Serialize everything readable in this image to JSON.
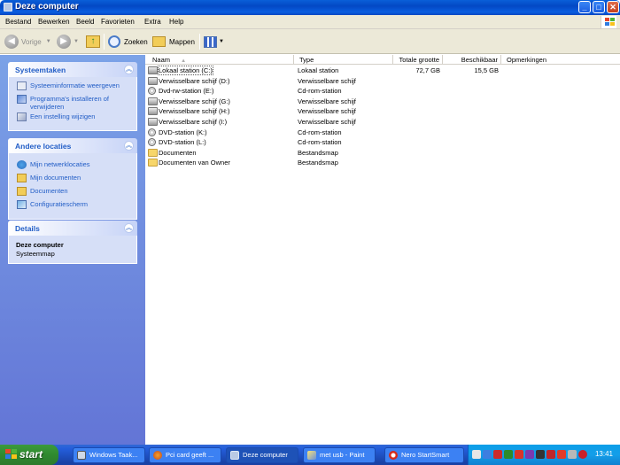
{
  "window": {
    "title": "Deze computer"
  },
  "menu": [
    "Bestand",
    "Bewerken",
    "Beeld",
    "Favorieten",
    "Extra",
    "Help"
  ],
  "toolbar": {
    "back": "Vorige",
    "search": "Zoeken",
    "folders": "Mappen"
  },
  "tasks_system": {
    "title": "Systeemtaken",
    "items": [
      "Systeeminformatie weergeven",
      "Programma's installeren of verwijderen",
      "Een instelling wijzigen"
    ]
  },
  "tasks_other": {
    "title": "Andere locaties",
    "items": [
      "Mijn netwerklocaties",
      "Mijn documenten",
      "Documenten",
      "Configuratiescherm"
    ]
  },
  "details": {
    "title": "Details",
    "name": "Deze computer",
    "desc": "Systeemmap"
  },
  "columns": [
    "Naam",
    "Type",
    "Totale grootte",
    "Beschikbaar",
    "Opmerkingen"
  ],
  "files": [
    {
      "name": "Lokaal station (C:)",
      "type": "Lokaal station",
      "size": "72,7 GB",
      "free": "15,5 GB",
      "icon": "hard-drive-icon"
    },
    {
      "name": "Verwisselbare schijf (D:)",
      "type": "Verwisselbare schijf",
      "size": "",
      "free": "",
      "icon": "removable-drive-icon"
    },
    {
      "name": "Dvd-rw-station (E:)",
      "type": "Cd-rom-station",
      "size": "",
      "free": "",
      "icon": "cd-drive-icon"
    },
    {
      "name": "Verwisselbare schijf (G:)",
      "type": "Verwisselbare schijf",
      "size": "",
      "free": "",
      "icon": "removable-drive-icon"
    },
    {
      "name": "Verwisselbare schijf (H:)",
      "type": "Verwisselbare schijf",
      "size": "",
      "free": "",
      "icon": "removable-drive-icon"
    },
    {
      "name": "Verwisselbare schijf (I:)",
      "type": "Verwisselbare schijf",
      "size": "",
      "free": "",
      "icon": "removable-drive-icon"
    },
    {
      "name": "DVD-station (K:)",
      "type": "Cd-rom-station",
      "size": "",
      "free": "",
      "icon": "cd-drive-icon"
    },
    {
      "name": "DVD-station (L:)",
      "type": "Cd-rom-station",
      "size": "",
      "free": "",
      "icon": "cd-drive-icon"
    },
    {
      "name": "Documenten",
      "type": "Bestandsmap",
      "size": "",
      "free": "",
      "icon": "folder-icon"
    },
    {
      "name": "Documenten van Owner",
      "type": "Bestandsmap",
      "size": "",
      "free": "",
      "icon": "folder-icon"
    }
  ],
  "taskbar": {
    "start": "start",
    "tasks": [
      "Windows Taak...",
      "Pci card geeft ...",
      "Deze computer",
      "met usb - Paint",
      "Nero StartSmart"
    ],
    "clock": "13:41"
  }
}
